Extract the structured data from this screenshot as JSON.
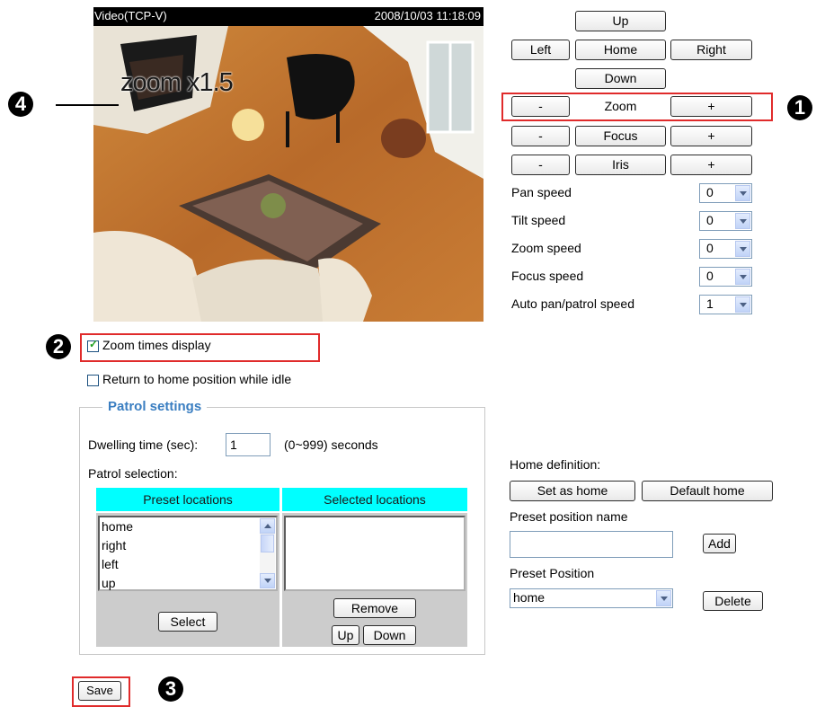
{
  "video": {
    "title": "Video(TCP-V)",
    "timestamp": "2008/10/03 11:18:09",
    "zoom_overlay": "zoom x1.5"
  },
  "callouts": {
    "c1": "1",
    "c2": "2",
    "c3": "3",
    "c4": "4"
  },
  "ptz": {
    "up": "Up",
    "left": "Left",
    "home": "Home",
    "right": "Right",
    "down": "Down",
    "zoom_minus": "-",
    "zoom_label": "Zoom",
    "zoom_plus": "+",
    "focus_minus": "-",
    "focus_label": "Focus",
    "focus_plus": "+",
    "iris_minus": "-",
    "iris_label": "Iris",
    "iris_plus": "+"
  },
  "speeds": [
    {
      "label": "Pan speed",
      "value": "0"
    },
    {
      "label": "Tilt speed",
      "value": "0"
    },
    {
      "label": "Zoom speed",
      "value": "0"
    },
    {
      "label": "Focus speed",
      "value": "0"
    },
    {
      "label": "Auto pan/patrol speed",
      "value": "1"
    }
  ],
  "options": {
    "zoom_times_display": {
      "label": "Zoom times display",
      "checked": true
    },
    "return_home": {
      "label": "Return to home position while idle",
      "checked": false
    }
  },
  "patrol": {
    "legend": "Patrol settings",
    "dwelling_label": "Dwelling time (sec):",
    "dwelling_value": "1",
    "dwelling_hint": "(0~999) seconds",
    "selection_label": "Patrol selection:",
    "preset_header": "Preset locations",
    "selected_header": "Selected locations",
    "preset_items": [
      "home",
      "right",
      "left",
      "up"
    ],
    "select_button": "Select",
    "remove_button": "Remove",
    "up_button": "Up",
    "down_button": "Down"
  },
  "home_definition": {
    "label": "Home definition:",
    "set_as_home": "Set as home",
    "default_home": "Default home",
    "preset_name_label": "Preset position name",
    "preset_name_value": "",
    "add_button": "Add",
    "preset_position_label": "Preset Position",
    "preset_position_value": "home",
    "delete_button": "Delete"
  },
  "save_button": "Save",
  "colors": {
    "callout_box": "#e02b2b",
    "table_header": "#00ffff",
    "legend_text": "#3a7ec1"
  }
}
